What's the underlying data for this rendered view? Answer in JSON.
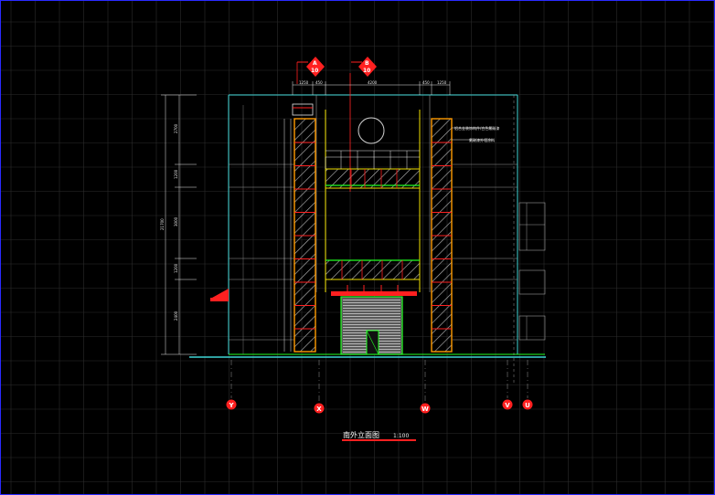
{
  "drawing": {
    "title": "南外立面图",
    "scale": "1:100",
    "axes": [
      "Y",
      "X",
      "W",
      "V",
      "U"
    ],
    "section_marks": [
      {
        "letter": "A",
        "sheet": "10"
      },
      {
        "letter": "B",
        "sheet": "10"
      }
    ],
    "top_dimensions": [
      "1250",
      "450",
      "4200",
      "450",
      "1250"
    ],
    "left_dimensions": [
      "2700",
      "1200",
      "3000",
      "1200",
      "2400"
    ],
    "left_total": "21700",
    "notes": [
      "铝合金装饰构件/白色氟碳漆",
      "氟碳漆外墙涂料"
    ]
  },
  "colors": {
    "background": "#000000",
    "grid": "#2c2c2c",
    "cyan": "#3fd6d6",
    "yellow": "#f0e000",
    "orange": "#ff9a00",
    "red": "#ff2020",
    "green": "#20ff20",
    "white": "#e8e8e8",
    "gray": "#9a9a9a"
  }
}
